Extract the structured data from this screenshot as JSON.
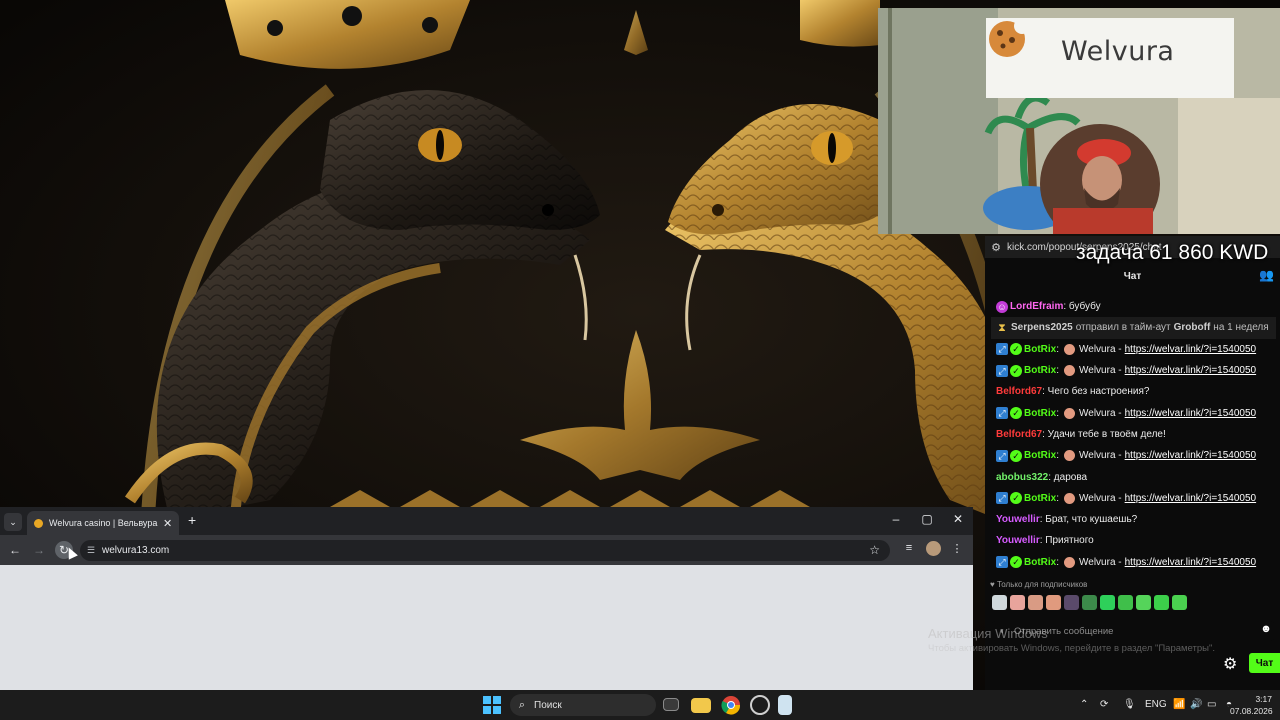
{
  "goal_overlay": "задача 61 860 KWD",
  "webcam": {
    "sign_text": "Welvura"
  },
  "chat": {
    "url": "kick.com/popout/serpens2025/chat",
    "title": "Чат",
    "messages": [
      {
        "type": "user",
        "badges": [
          "og"
        ],
        "user": "LordEfraim",
        "user_color": "#ff67f0",
        "text": ": бубубу"
      },
      {
        "type": "system",
        "user": "Serpens2025",
        "text": "отправил в тайм-аут",
        "target": "Groboff",
        "suffix": "на 1 неделя"
      },
      {
        "type": "bot",
        "user": "BotRix",
        "user_color": "#53fc18",
        "prefix": ": ",
        "text": "Welvura - ",
        "link": "https://welvar.link/?i=1540050"
      },
      {
        "type": "bot",
        "user": "BotRix",
        "user_color": "#53fc18",
        "prefix": ": ",
        "text": "Welvura - ",
        "link": "https://welvar.link/?i=1540050"
      },
      {
        "type": "user",
        "badges": [],
        "user": "Belford67",
        "user_color": "#ff3b3b",
        "text": ": Чего без настроения?"
      },
      {
        "type": "bot",
        "user": "BotRix",
        "user_color": "#53fc18",
        "prefix": ": ",
        "text": "Welvura - ",
        "link": "https://welvar.link/?i=1540050"
      },
      {
        "type": "user",
        "badges": [],
        "user": "Belford67",
        "user_color": "#ff3b3b",
        "text": ": Удачи тебе в твоём деле!"
      },
      {
        "type": "bot",
        "user": "BotRix",
        "user_color": "#53fc18",
        "prefix": ": ",
        "text": "Welvura - ",
        "link": "https://welvar.link/?i=1540050"
      },
      {
        "type": "user",
        "badges": [],
        "user": "abobus322",
        "user_color": "#72f26a",
        "text": ": дарова"
      },
      {
        "type": "bot",
        "user": "BotRix",
        "user_color": "#53fc18",
        "prefix": ": ",
        "text": "Welvura - ",
        "link": "https://welvar.link/?i=1540050"
      },
      {
        "type": "user",
        "badges": [],
        "user": "Youwellir",
        "user_color": "#d65cff",
        "text": ": Брат, что кушаешь?"
      },
      {
        "type": "user",
        "badges": [],
        "user": "Youwellir",
        "user_color": "#d65cff",
        "text": ": Приятного"
      },
      {
        "type": "bot",
        "user": "BotRix",
        "user_color": "#53fc18",
        "prefix": ": ",
        "text": "Welvura - ",
        "link": "https://welvar.link/?i=1540050"
      }
    ],
    "subscribers_only": "Только для подписчиков",
    "emote_colors": [
      "#cfd8dc",
      "#e8a49c",
      "#d99b84",
      "#e09a7e",
      "#5a4a6a",
      "#3c8a4a",
      "#2ed05a",
      "#3fbf4a",
      "#55d45a",
      "#3ccf4a",
      "#4ad14f"
    ],
    "input_placeholder": "Отправить сообщение",
    "send_label": "Чат",
    "accent": "#53fc18"
  },
  "windows_activation": {
    "title": "Активация Windows",
    "subtitle": "Чтобы активировать Windows, перейдите в раздел \"Параметры\"."
  },
  "browser": {
    "tab_title": "Welvura casino | Вельвура казино",
    "address": "welvura13.com"
  },
  "taskbar": {
    "search_label": "Поиск",
    "language": "ENG",
    "time": "3:17",
    "date": "07.08.2026"
  }
}
